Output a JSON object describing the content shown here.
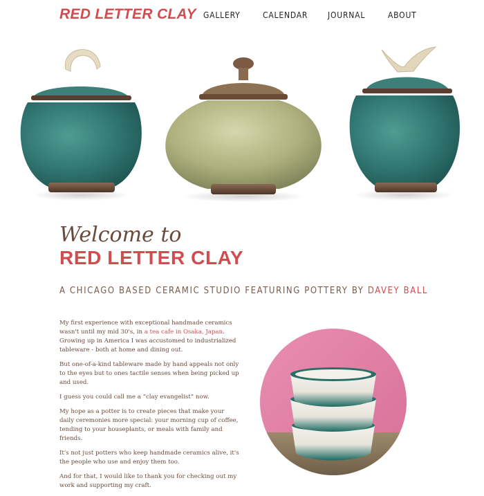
{
  "header": {
    "logo": "RED LETTER CLAY",
    "nav": [
      "GALLERY",
      "CALENDAR",
      "JOURNAL",
      "ABOUT"
    ]
  },
  "hero": {
    "alt": "Three lidded ceramic jars: teal jar with loop handle, green round jar with knob lid, teal jar with bird finial"
  },
  "intro": {
    "welcome": "Welcome to",
    "brand": "RED LETTER CLAY",
    "tagline_prefix": "A CHICAGO BASED CERAMIC STUDIO FEATURING POTTERY BY ",
    "tagline_name": "DAVEY BALL"
  },
  "body": {
    "p1_a": "My first experience with exceptional handmade ceramics wasn't until my mid 30's, in ",
    "p1_link": "a tea cafe in Osaka, Japan",
    "p1_b": ". Growing up in America I was accustomed to industrialized tableware - both at home and dining out.",
    "p2": "But one-of-a-kind tableware made by hand appeals not only to the eyes but to ones tactile senses when being picked up and used.",
    "p3": "I guess you could call me a “clay evangelist” now.",
    "p4": "My hope as a potter is to create pieces that make your daily ceremonies more special: your morning cup of coffee, tending to your houseplants, or meals with family and friends.",
    "p5": "It's not just potters who keep handmade ceramics alive, it's the people who use and enjoy them too.",
    "p6": "And for that, I would like to thank you for checking out my work and supporting my craft."
  },
  "photo": {
    "alt": "Stack of three white bowls with teal drip glaze on a pink background"
  }
}
